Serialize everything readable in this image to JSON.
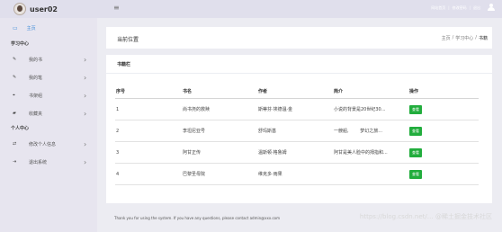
{
  "header": {
    "username": "user02",
    "top_links": [
      "网站首页",
      "|",
      "修改密码",
      "|",
      "退出"
    ]
  },
  "sidebar": {
    "home": "主页",
    "sections": [
      {
        "title": "学习中心",
        "items": [
          "我的书",
          "我的笔",
          "书架组",
          "收藏夹"
        ]
      },
      {
        "title": "个人中心",
        "items": [
          "修改个人信息",
          "退出系统"
        ]
      }
    ]
  },
  "page": {
    "title": "当前位置",
    "breadcrumb": [
      "主页",
      "/",
      "学习中心",
      "/",
      "书籍"
    ]
  },
  "panel": {
    "title": "书籍栏",
    "columns": [
      "序号",
      "书名",
      "作者",
      "简介",
      "操作"
    ],
    "rows": [
      {
        "no": "1",
        "name": "尚书尧的救赎",
        "author": "斯蒂芬·埃德温·金",
        "intro": "小说的背景是20世纪30...",
        "action": "查看"
      },
      {
        "no": "2",
        "name": "李坦尼亚号",
        "author": "舒玛斯基",
        "intro": "一艘船,        梦幻之旅...",
        "action": "查看"
      },
      {
        "no": "3",
        "name": "阿甘正传",
        "author": "温斯顿·格鲁姆",
        "intro": "阿甘是美人脸中的拇指和...",
        "action": "查看"
      },
      {
        "no": "4",
        "name": "巴黎圣母院",
        "author": "维克多·雨果",
        "intro": "",
        "action": "查看"
      }
    ]
  },
  "footer": {
    "text": "Thank you for using the system. If you have any questions, please contact admin@xxx.com",
    "watermark": "https://blog.csdn.net/… @稀土掘金技术社区"
  }
}
